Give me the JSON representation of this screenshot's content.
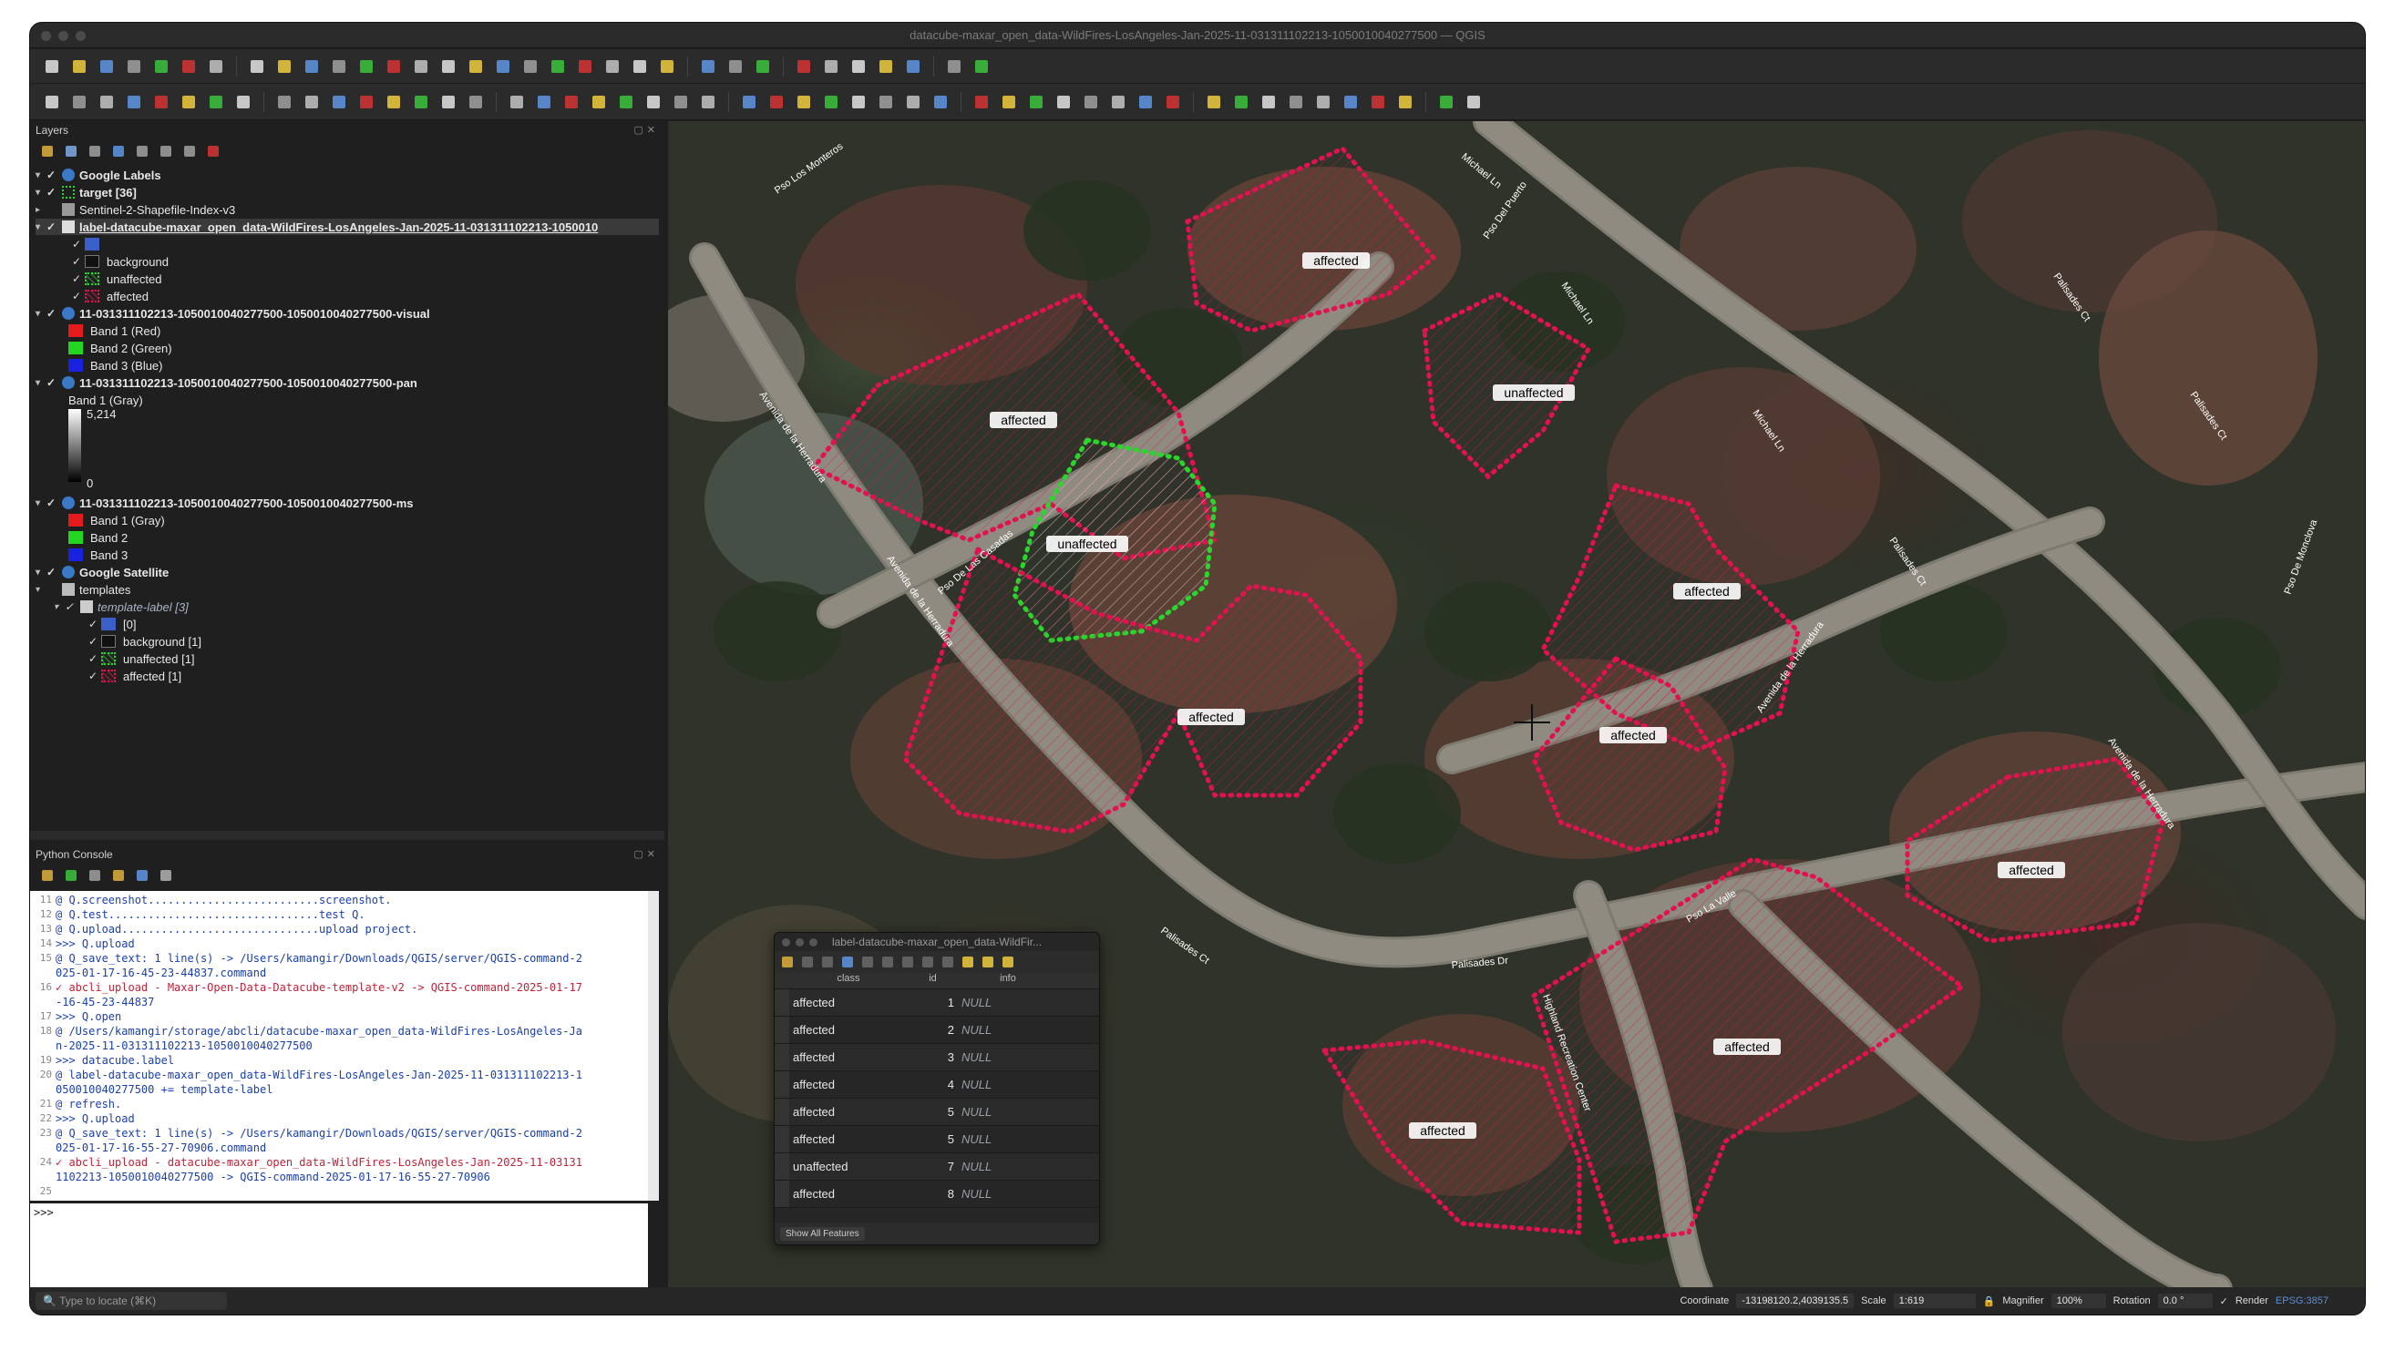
{
  "window": {
    "title": "datacube-maxar_open_data-WildFires-LosAngeles-Jan-2025-11-031311102213-1050010040277500 — QGIS"
  },
  "toolbar_icons": [
    "new-project-icon",
    "open-project-icon",
    "save-project-icon",
    "save-as-icon",
    "print-layout-icon",
    "layout-manager-icon",
    "style-manager-icon",
    "pan-icon",
    "pan-to-selection-icon",
    "zoom-in-icon",
    "zoom-out-icon",
    "zoom-full-icon",
    "zoom-to-selection-icon",
    "zoom-to-layer-icon",
    "zoom-native-icon",
    "zoom-last-icon",
    "zoom-next-icon",
    "new-map-view-icon",
    "new-3d-view-icon",
    "bookmark-icon",
    "show-bookmarks-icon",
    "temporal-icon",
    "refresh-icon",
    "select-icon",
    "select-value-icon",
    "deselect-icon",
    "identify-icon",
    "attribute-table-icon",
    "field-calc-icon",
    "statistics-icon",
    "measure-icon",
    "annotation-icon",
    "map-tips-icon"
  ],
  "layers_panel": {
    "title": "Layers",
    "items": [
      {
        "label": "Google Labels",
        "bold": true
      },
      {
        "label": "target [36]",
        "bold": true
      },
      {
        "label": "Sentinel-2-Shapefile-Index-v3"
      },
      {
        "label": "label-datacube-maxar_open_data-WildFires-LosAngeles-Jan-2025-11-031311102213-1050010",
        "bold": true
      },
      {
        "label": ""
      },
      {
        "label": "background"
      },
      {
        "label": "unaffected"
      },
      {
        "label": "affected"
      },
      {
        "label": "11-031311102213-1050010040277500-1050010040277500-visual",
        "bold": true
      },
      {
        "label": "Band 1 (Red)"
      },
      {
        "label": "Band 2 (Green)"
      },
      {
        "label": "Band 3 (Blue)"
      },
      {
        "label": "11-031311102213-1050010040277500-1050010040277500-pan",
        "bold": true
      },
      {
        "label": "Band 1 (Gray)"
      },
      {
        "label": "5,214"
      },
      {
        "label": "0"
      },
      {
        "label": "11-031311102213-1050010040277500-1050010040277500-ms",
        "bold": true
      },
      {
        "label": "Band 1 (Gray)"
      },
      {
        "label": "Band 2"
      },
      {
        "label": "Band 3"
      },
      {
        "label": "Google Satellite",
        "bold": true
      },
      {
        "label": "templates"
      },
      {
        "label": "template-label [3]",
        "italic": true
      },
      {
        "label": "[0]"
      },
      {
        "label": "background [1]"
      },
      {
        "label": "unaffected [1]"
      },
      {
        "label": "affected [1]"
      }
    ]
  },
  "python_console": {
    "title": "Python Console",
    "lines": [
      {
        "n": "11",
        "text": "@ Q.screenshot..........................screenshot."
      },
      {
        "n": "12",
        "text": "@ Q.test................................test Q."
      },
      {
        "n": "13",
        "text": "@ Q.upload..............................upload project."
      },
      {
        "n": "14",
        "text": ">>> Q.upload"
      },
      {
        "n": "15",
        "text": "@ Q_save_text: 1 line(s) -> /Users/kamangir/Downloads/QGIS/server/QGIS-command-2"
      },
      {
        "n": "",
        "text": "025-01-17-16-45-23-44837.command"
      },
      {
        "n": "16",
        "text": "✓ abcli_upload - Maxar-Open-Data-Datacube-template-v2 -> QGIS-command-2025-01-17"
      },
      {
        "n": "",
        "text": "-16-45-23-44837"
      },
      {
        "n": "17",
        "text": ">>> Q.open"
      },
      {
        "n": "18",
        "text": "@ /Users/kamangir/storage/abcli/datacube-maxar_open_data-WildFires-LosAngeles-Ja"
      },
      {
        "n": "",
        "text": "n-2025-11-031311102213-1050010040277500"
      },
      {
        "n": "19",
        "text": ">>> datacube.label"
      },
      {
        "n": "20",
        "text": "@ label-datacube-maxar_open_data-WildFires-LosAngeles-Jan-2025-11-031311102213-1"
      },
      {
        "n": "",
        "text": "050010040277500 += template-label"
      },
      {
        "n": "21",
        "text": "@ refresh."
      },
      {
        "n": "22",
        "text": ">>> Q.upload"
      },
      {
        "n": "23",
        "text": "@ Q_save_text: 1 line(s) -> /Users/kamangir/Downloads/QGIS/server/QGIS-command-2"
      },
      {
        "n": "",
        "text": "025-01-17-16-55-27-70906.command"
      },
      {
        "n": "24",
        "text": "✓ abcli_upload - datacube-maxar_open_data-WildFires-LosAngeles-Jan-2025-11-03131"
      },
      {
        "n": "",
        "text": "1102213-1050010040277500 -> QGIS-command-2025-01-17-16-55-27-70906"
      },
      {
        "n": "25",
        "text": ""
      }
    ],
    "prompt": ">>>"
  },
  "attribute_table": {
    "title": "label-datacube-maxar_open_data-WildFir...",
    "columns": [
      "class",
      "id",
      "info"
    ],
    "rows": [
      {
        "class": "affected",
        "id": "1",
        "info": "NULL"
      },
      {
        "class": "affected",
        "id": "2",
        "info": "NULL"
      },
      {
        "class": "affected",
        "id": "3",
        "info": "NULL"
      },
      {
        "class": "affected",
        "id": "4",
        "info": "NULL"
      },
      {
        "class": "affected",
        "id": "5",
        "info": "NULL"
      },
      {
        "class": "affected",
        "id": "5",
        "info": "NULL"
      },
      {
        "class": "unaffected",
        "id": "7",
        "info": "NULL"
      },
      {
        "class": "affected",
        "id": "8",
        "info": "NULL"
      }
    ],
    "footer": "Show All Features"
  },
  "map": {
    "labels": [
      "affected",
      "affected",
      "unaffected",
      "unaffected",
      "affected",
      "affected",
      "affected",
      "affected",
      "affected",
      "affected"
    ],
    "roads": [
      "Pso Los Monteros",
      "Michael Ln",
      "Pso Del Puerto",
      "Avenida de la Herradura",
      "Avenida de la Herradura",
      "Pso De Las Casadas",
      "Michael Ln",
      "Michael Ln",
      "Palisades Ct",
      "Palisades Ct",
      "Palisades Ct",
      "Pso De Monclova",
      "Avenida de la Herradura",
      "Avenida de la Herradura",
      "Pso La Valle",
      "Palisades Ct",
      "Palisades Dr",
      "Highland Recreation Center"
    ],
    "colors": {
      "affected": "#e0124f",
      "unaffected": "#29d62c"
    }
  },
  "statusbar": {
    "locator_placeholder": "Type to locate (⌘K)",
    "coordinate_label": "Coordinate",
    "coordinate_value": "-13198120.2,4039135.5",
    "scale_label": "Scale",
    "scale_value": "1:619",
    "magnifier_label": "Magnifier",
    "magnifier_value": "100%",
    "rotation_label": "Rotation",
    "rotation_value": "0.0 °",
    "render_label": "Render",
    "crs": "EPSG:3857"
  }
}
